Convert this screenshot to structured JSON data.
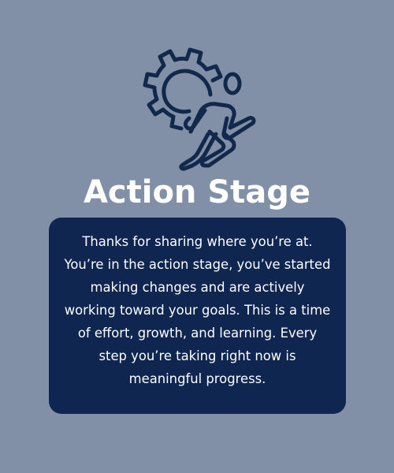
{
  "icon": {
    "name": "gear-runner-icon",
    "color": "#13294b"
  },
  "colors": {
    "background": "#8190a7",
    "card": "#0e2650",
    "text": "#ffffff"
  },
  "title": "Action Stage",
  "message": "Thanks for sharing where you’re at. You’re in the action stage, you’ve started making changes and are actively working toward your goals. This is a time of effort, growth, and learning. Every step you’re taking right now is meaningful progress."
}
